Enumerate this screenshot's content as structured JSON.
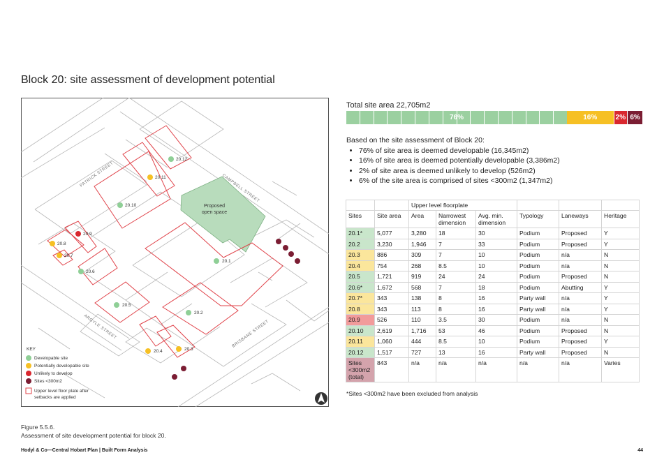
{
  "title": "Block 20: site assessment of development potential",
  "colors": {
    "developable": "#8fcf96",
    "potential": "#f6c024",
    "unlikely": "#d9272e",
    "small": "#7b1d33",
    "openspace": "#b8dcbc"
  },
  "map": {
    "streets": [
      "PATRICK STREET",
      "CAMPBELL STREET",
      "ARGYLE STREET",
      "BRISBANE STREET"
    ],
    "open_space_label": [
      "Proposed",
      "open space"
    ],
    "sites": [
      {
        "id": "20.1",
        "cat": "developable"
      },
      {
        "id": "20.2",
        "cat": "developable"
      },
      {
        "id": "20.3",
        "cat": "potential"
      },
      {
        "id": "20.4",
        "cat": "potential"
      },
      {
        "id": "20.5",
        "cat": "developable"
      },
      {
        "id": "20.6",
        "cat": "developable"
      },
      {
        "id": "20.7",
        "cat": "potential"
      },
      {
        "id": "20.8",
        "cat": "potential"
      },
      {
        "id": "20.9",
        "cat": "unlikely"
      },
      {
        "id": "20.10",
        "cat": "developable"
      },
      {
        "id": "20.11",
        "cat": "potential"
      },
      {
        "id": "20.12",
        "cat": "developable"
      }
    ],
    "key": {
      "title": "KEY",
      "developable": "Developable site",
      "potential": "Potentially developable site",
      "unlikely": "Unlikely to develop",
      "small": "Sites <300m2",
      "outline_1": "Upper level floor plate after",
      "outline_2": "setbacks are applied"
    }
  },
  "total_area": "Total site area 22,705m2",
  "bar": [
    {
      "pct": 76,
      "label": "76%",
      "cat": "developable"
    },
    {
      "pct": 16,
      "label": "16%",
      "cat": "potential"
    },
    {
      "pct": 2,
      "label": "2%",
      "cat": "unlikely"
    },
    {
      "pct": 6,
      "label": "6%",
      "cat": "small"
    }
  ],
  "summary": {
    "intro": "Based on the site assessment of Block 20:",
    "bullets": [
      "76% of site area is deemed developable (16,345m2)",
      "16% of site area is deemed potentially developable (3,386m2)",
      "2% of site area is deemed unlikely to develop (526m2)",
      "6% of the site area is comprised of sites <300m2 (1,347m2)"
    ]
  },
  "table": {
    "group_header": "Upper level floorplate",
    "headers": [
      "Sites",
      "Site area",
      "Area",
      "Narrowest dimension",
      "Avg. min. dimension",
      "Typology",
      "Laneways",
      "Heritage"
    ],
    "rows": [
      {
        "cat": "developable",
        "cells": [
          "20.1*",
          "5,077",
          "3,280",
          "18",
          "30",
          "Podium",
          "Proposed",
          "Y"
        ]
      },
      {
        "cat": "developable",
        "cells": [
          "20.2",
          "3,230",
          "1,946",
          "7",
          "33",
          "Podium",
          "Proposed",
          "Y"
        ]
      },
      {
        "cat": "potential",
        "cells": [
          "20.3",
          "886",
          "309",
          "7",
          "10",
          "Podium",
          "n/a",
          "N"
        ]
      },
      {
        "cat": "potential",
        "cells": [
          "20.4",
          "754",
          "268",
          "8.5",
          "10",
          "Podium",
          "n/a",
          "N"
        ]
      },
      {
        "cat": "developable",
        "cells": [
          "20.5",
          "1,721",
          "919",
          "24",
          "24",
          "Podium",
          "Proposed",
          "N"
        ]
      },
      {
        "cat": "developable",
        "cells": [
          "20.6*",
          "1,672",
          "568",
          "7",
          "18",
          "Podium",
          "Abutting",
          "Y"
        ]
      },
      {
        "cat": "potential",
        "cells": [
          "20.7*",
          "343",
          "138",
          "8",
          "16",
          "Party wall",
          "n/a",
          "Y"
        ]
      },
      {
        "cat": "potential",
        "cells": [
          "20.8",
          "343",
          "113",
          "8",
          "16",
          "Party wall",
          "n/a",
          "Y"
        ]
      },
      {
        "cat": "unlikely",
        "cells": [
          "20.9",
          "526",
          "110",
          "3.5",
          "30",
          "Podium",
          "n/a",
          "N"
        ]
      },
      {
        "cat": "developable",
        "cells": [
          "20.10",
          "2,619",
          "1,716",
          "53",
          "46",
          "Podium",
          "Proposed",
          "N"
        ]
      },
      {
        "cat": "potential",
        "cells": [
          "20.11",
          "1,060",
          "444",
          "8.5",
          "10",
          "Podium",
          "Proposed",
          "Y"
        ]
      },
      {
        "cat": "developable",
        "cells": [
          "20.12",
          "1,517",
          "727",
          "13",
          "16",
          "Party wall",
          "Proposed",
          "N"
        ]
      },
      {
        "cat": "small",
        "cells": [
          "Sites <300m2 (total)",
          "843",
          "n/a",
          "n/a",
          "n/a",
          "n/a",
          "n/a",
          "Varies"
        ]
      }
    ]
  },
  "footnote": "*Sites <300m2 have been excluded from analysis",
  "caption": {
    "figure": "Figure 5.5.6.",
    "text": "Assessment of site development potential for block 20."
  },
  "footer": "Hodyl & Co—Central Hobart Plan | Built Form Analysis",
  "page_number": "44"
}
